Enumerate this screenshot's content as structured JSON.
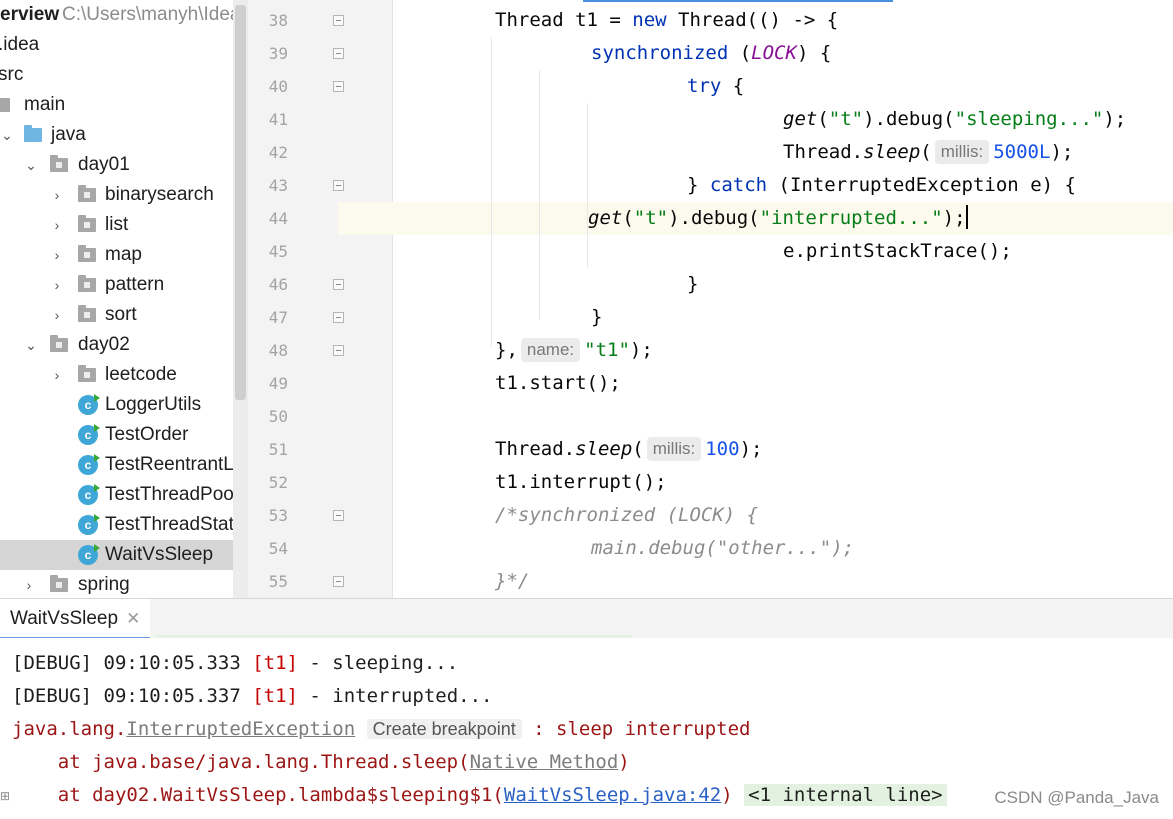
{
  "project": {
    "header_title": "erview",
    "header_path": "C:\\Users\\manyh\\IdeaP",
    "items": [
      {
        "label": ".idea",
        "kind": "none",
        "indent": 0
      },
      {
        "label": "src",
        "kind": "none",
        "indent": 0
      },
      {
        "label": "main",
        "kind": "folder",
        "indent": 0
      },
      {
        "label": "java",
        "kind": "src",
        "indent": 1
      },
      {
        "label": "day01",
        "kind": "pkg",
        "indent": 2
      },
      {
        "label": "binarysearch",
        "kind": "pkg",
        "indent": 3
      },
      {
        "label": "list",
        "kind": "pkg",
        "indent": 3
      },
      {
        "label": "map",
        "kind": "pkg",
        "indent": 3
      },
      {
        "label": "pattern",
        "kind": "pkg",
        "indent": 3
      },
      {
        "label": "sort",
        "kind": "pkg",
        "indent": 3
      },
      {
        "label": "day02",
        "kind": "pkg",
        "indent": 2
      },
      {
        "label": "leetcode",
        "kind": "pkg",
        "indent": 3
      },
      {
        "label": "LoggerUtils",
        "kind": "class",
        "indent": 3
      },
      {
        "label": "TestOrder",
        "kind": "class",
        "indent": 3
      },
      {
        "label": "TestReentrantLo",
        "kind": "class",
        "indent": 3
      },
      {
        "label": "TestThreadPoolE",
        "kind": "class",
        "indent": 3
      },
      {
        "label": "TestThreadState",
        "kind": "class",
        "indent": 3
      },
      {
        "label": "WaitVsSleep",
        "kind": "class",
        "indent": 3,
        "selected": true
      },
      {
        "label": "spring",
        "kind": "pkg",
        "indent": 2
      }
    ]
  },
  "editor": {
    "line_numbers": [
      "38",
      "39",
      "40",
      "41",
      "42",
      "43",
      "44",
      "45",
      "46",
      "47",
      "48",
      "49",
      "50",
      "51",
      "52",
      "53",
      "54",
      "55"
    ],
    "code": {
      "l38": {
        "a": "Thread t1 = ",
        "kw": "new",
        "b": " Thread(() -> {"
      },
      "l39": {
        "kw": "synchronized",
        "a": " (",
        "const": "LOCK",
        "b": ") {"
      },
      "l40": {
        "kw": "try",
        "a": " {"
      },
      "l41": {
        "it": "get",
        "a": "(",
        "s1": "\"t\"",
        "b": ").debug(",
        "s2": "\"sleeping...\"",
        "c": ");"
      },
      "l42": {
        "a": "Thread.",
        "it": "sleep",
        "b": "(",
        "hint": "millis:",
        "num": "5000L",
        "c": ");"
      },
      "l43": {
        "a": "} ",
        "kw": "catch",
        "b": " (InterruptedException e) {"
      },
      "l44": {
        "it": "get",
        "a": "(",
        "s1": "\"t\"",
        "b": ").debug(",
        "s2": "\"interrupted...\"",
        "c": ");"
      },
      "l45": {
        "a": "e.printStackTrace();"
      },
      "l46": {
        "a": "}"
      },
      "l47": {
        "a": "}"
      },
      "l48": {
        "a": "},",
        "hint": "name:",
        "str": "\"t1\"",
        "b": ");"
      },
      "l49": {
        "a": "t1.start();"
      },
      "l51": {
        "a": "Thread.",
        "it": "sleep",
        "b": "(",
        "hint": "millis:",
        "num": "100",
        "c": ");"
      },
      "l52": {
        "a": "t1.interrupt();"
      },
      "l53": {
        "a": "/*synchronized (LOCK) {"
      },
      "l54": {
        "a": "main.debug(\"other...\");"
      },
      "l55": {
        "a": "}*/"
      }
    }
  },
  "run": {
    "tab_label": "WaitVsSleep",
    "lines": {
      "d1": {
        "prefix": "[DEBUG] 09:10:05.333 ",
        "thread": "[t1]",
        "msg": " - sleeping..."
      },
      "d2": {
        "prefix": "[DEBUG] 09:10:05.337 ",
        "thread": "[t1]",
        "msg": " - interrupted..."
      },
      "e1": {
        "a": "java.lang.",
        "link": "InterruptedException",
        "bp": "Create breakpoint",
        "b": " : sleep interrupted"
      },
      "e2": {
        "a": "    at java.base/java.lang.Thread.sleep(",
        "link": "Native Method",
        "b": ")"
      },
      "e3": {
        "a": "    at day02.WaitVsSleep.lambda$sleeping$1(",
        "link": "WaitVsSleep.java:42",
        "b": ") ",
        "internal": "<1 internal line>"
      }
    }
  },
  "watermark": "CSDN @Panda_Java",
  "colors": {
    "keyword": "#0033b3",
    "string": "#067d17",
    "number": "#1750eb",
    "constant": "#871094",
    "thread": "#c50000",
    "error": "#9c1515"
  }
}
